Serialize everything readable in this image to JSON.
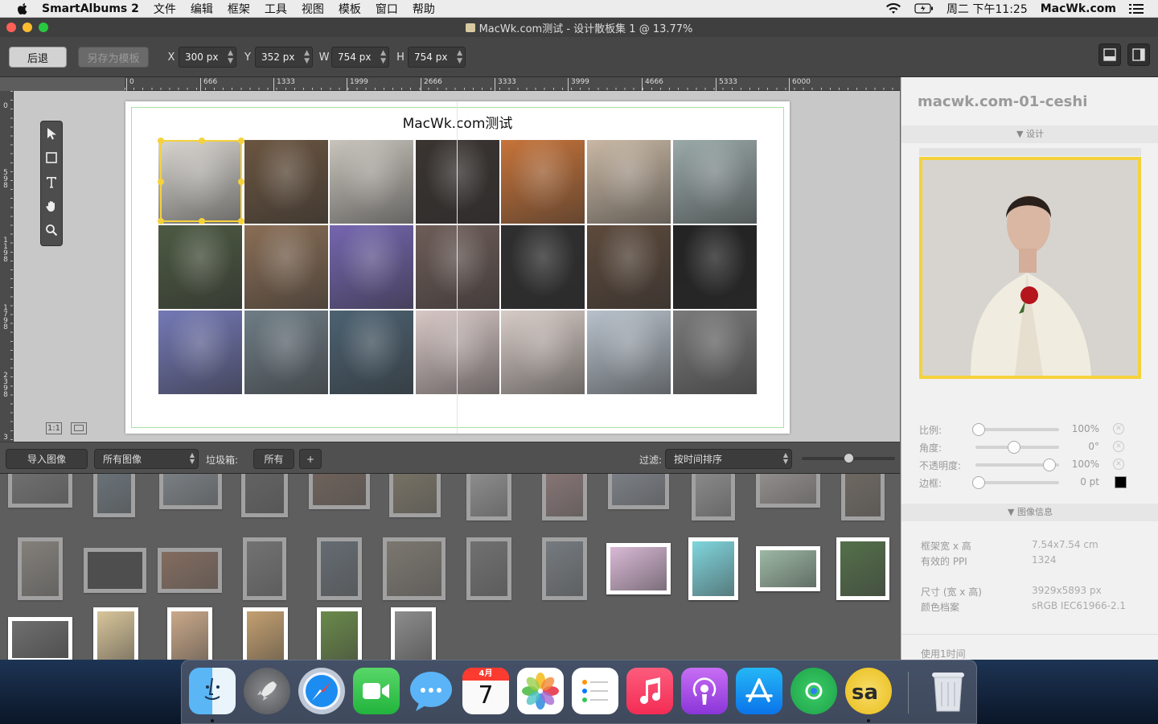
{
  "menubar": {
    "app_name": "SmartAlbums 2",
    "menus": [
      "文件",
      "编辑",
      "框架",
      "工具",
      "视图",
      "模板",
      "窗口",
      "帮助"
    ],
    "clock": "周二 下午11:25",
    "user": "MacWk.com"
  },
  "window": {
    "title": "MacWk.com测试 - 设计散板集 1 @ 13.77%"
  },
  "toolbar": {
    "back_label": "后退",
    "save_template_label": "另存为模板",
    "x_label": "X",
    "x_value": "300 px",
    "y_label": "Y",
    "y_value": "352 px",
    "w_label": "W",
    "w_value": "754 px",
    "h_label": "H",
    "h_value": "754 px"
  },
  "ruler": {
    "h_ticks": [
      "0",
      "666",
      "1333",
      "1999",
      "2666",
      "3333",
      "3999",
      "4666",
      "5333",
      "6000"
    ],
    "v_ticks": [
      "0",
      "598",
      "1198",
      "1798",
      "2398",
      "3"
    ]
  },
  "spread": {
    "title": "MacWk.com测试",
    "zoom_1to1": "1:1"
  },
  "photo_colors": [
    [
      "#d9d6d0",
      "#6b5540",
      "#c9c5bd",
      "#3a3431",
      "#c7743a",
      "#c9b8a4",
      "#9aa9a9"
    ],
    [
      "#4d5a42",
      "#8a6e56",
      "#7566b0",
      "#6e5d58",
      "#2f2f2f",
      "#5d4a3c",
      "#232323"
    ],
    [
      "#7479b6",
      "#6f7d86",
      "#4c6272",
      "#d8c8c6",
      "#d8ccc7",
      "#b8c2cc",
      "#7a7a7a"
    ]
  ],
  "bottombar": {
    "import_label": "导入图像",
    "source_select": "所有图像",
    "bin_label": "垃圾箱:",
    "bin_value": "所有",
    "add_label": "+",
    "filter_label": "过滤:",
    "sort_select": "按时间排序",
    "thumb_size": 0.5
  },
  "inspector": {
    "photo_name": "macwk.com-01-ceshi",
    "design_header": "▼ 设计",
    "scale_label": "比例:",
    "scale_value": "100%",
    "scale_level": 0,
    "angle_label": "角度:",
    "angle_value": "0°",
    "angle_level": 0.5,
    "opacity_label": "不透明度:",
    "opacity_value": "100%",
    "opacity_level": 1,
    "border_label": "边框:",
    "border_value": "0 pt",
    "border_level": 0,
    "info_header": "▼ 图像信息",
    "frame_size_label": "框架宽 x 高",
    "frame_size_value": "7.54x7.54 cm",
    "ppi_label": "有效的 PPI",
    "ppi_value": "1324",
    "dims_label": "尺寸 (宽 x 高)",
    "dims_value": "3929x5893 px",
    "profile_label": "颜色档案",
    "profile_value": "sRGB IEC61966-2.1",
    "used_label": "使用1时间"
  },
  "dock": {
    "calendar_month": "4月",
    "calendar_day": "7"
  },
  "colors": {
    "selection": "#f5d23c",
    "window_bg": "#5d5d5d"
  }
}
